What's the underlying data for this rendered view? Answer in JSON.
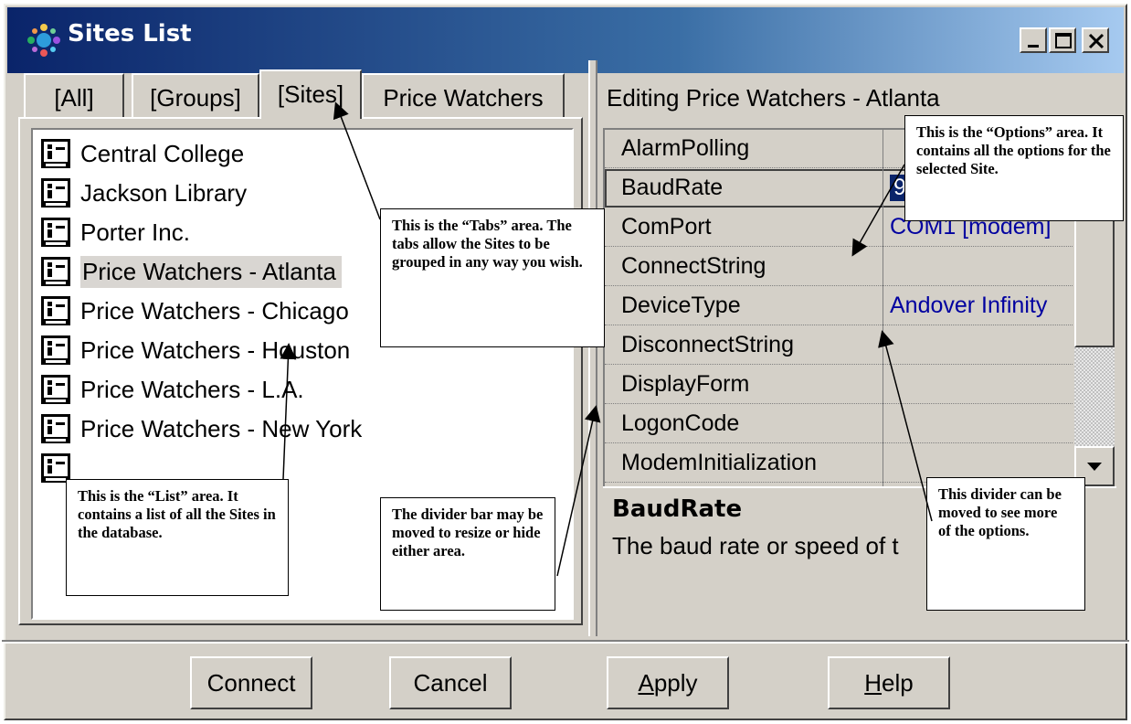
{
  "window": {
    "title": "Sites List",
    "icon": "network-globe-icon"
  },
  "tabs": [
    {
      "label": "[All]"
    },
    {
      "label": "[Groups]"
    },
    {
      "label": "[Sites]"
    },
    {
      "label": "Price Watchers"
    }
  ],
  "sites": [
    {
      "label": "Central College",
      "icon": "site-icon"
    },
    {
      "label": "Jackson Library",
      "icon": "site-icon"
    },
    {
      "label": "Porter Inc.",
      "icon": "site-icon"
    },
    {
      "label": "Price Watchers - Atlanta",
      "icon": "site-icon",
      "selected": true
    },
    {
      "label": "Price Watchers - Chicago",
      "icon": "site-icon"
    },
    {
      "label": "Price Watchers - Houston",
      "icon": "site-icon"
    },
    {
      "label": "Price Watchers - L.A.",
      "icon": "site-icon"
    },
    {
      "label": "Price Watchers - New York",
      "icon": "site-icon"
    }
  ],
  "editor": {
    "heading": "Editing Price Watchers - Atlanta",
    "properties": [
      {
        "name": "AlarmPolling",
        "value": ""
      },
      {
        "name": "BaudRate",
        "value": "9"
      },
      {
        "name": "ComPort",
        "value": "COM1 [modem]"
      },
      {
        "name": "ConnectString",
        "value": ""
      },
      {
        "name": "DeviceType",
        "value": "Andover Infinity"
      },
      {
        "name": "DisconnectString",
        "value": ""
      },
      {
        "name": "DisplayForm",
        "value": ""
      },
      {
        "name": "LogonCode",
        "value": ""
      },
      {
        "name": "ModemInitialization",
        "value": ""
      }
    ],
    "description_title": "BaudRate",
    "description_text": "The baud rate or speed of t"
  },
  "buttons": {
    "connect": "Connect",
    "cancel": "Cancel",
    "apply_accel": "A",
    "apply_rest": "pply",
    "help_accel": "H",
    "help_rest": "elp"
  },
  "annotations": {
    "tabs": "This is the “Tabs” area. The tabs allow the Sites to be grouped in any way you wish.",
    "options": "This is the “Options” area. It contains all the options for the selected Site.",
    "list": "This is the “List” area. It contains a list of all the Sites in the database.",
    "divider_bar": "The divider bar may be moved to resize or hide either area.",
    "divider": "This divider can be moved to see more of the options."
  },
  "colors": {
    "titlebar": "#0a246a",
    "face": "#d4d0c8",
    "value_text": "#0000a0"
  }
}
